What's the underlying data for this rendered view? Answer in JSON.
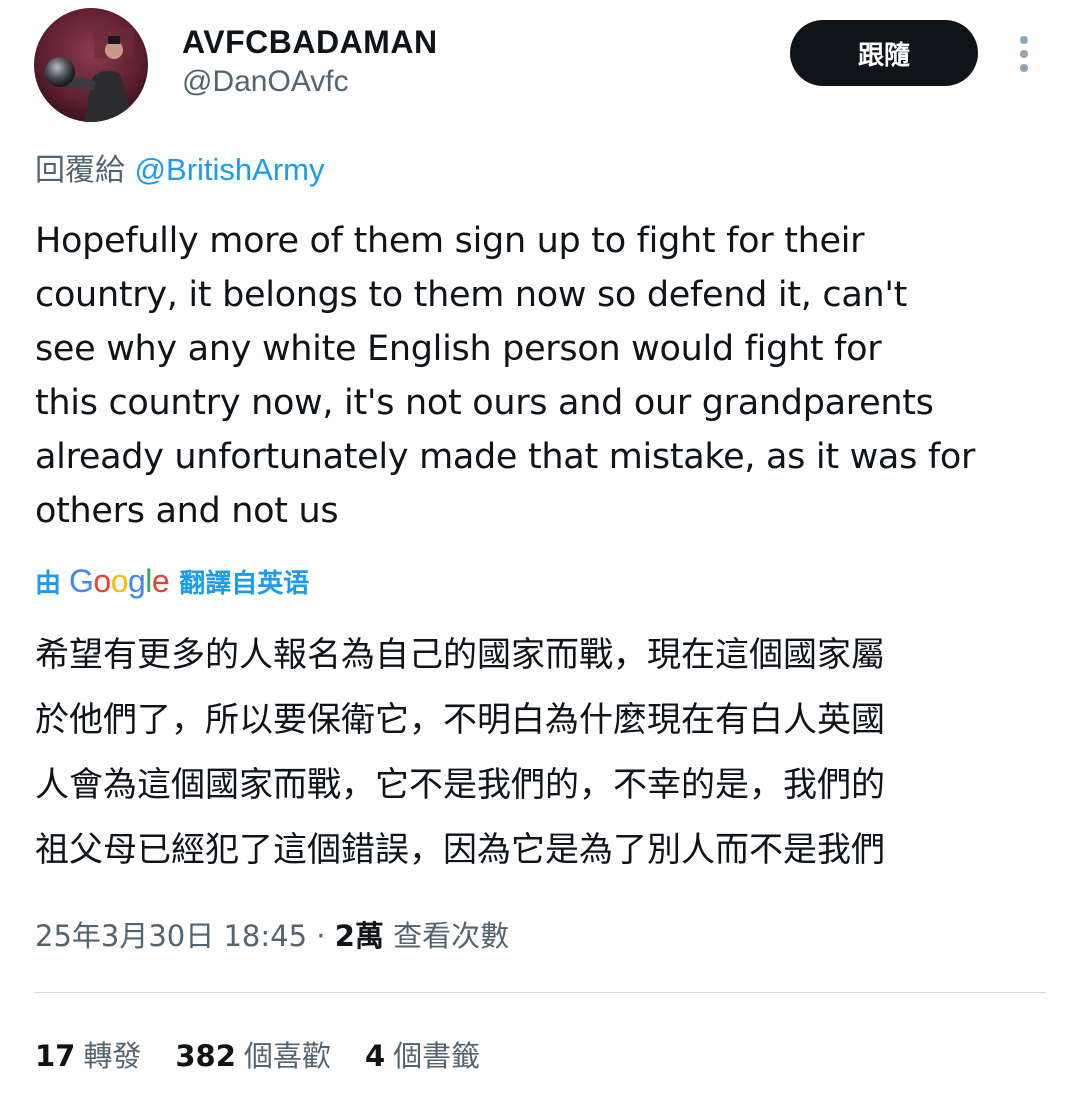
{
  "tweet": {
    "author": {
      "display_name": "AVFCBADAMAN",
      "handle": "@DanOAvfc"
    },
    "follow_label": "跟隨",
    "reply_prefix": "回覆給",
    "reply_to": "@BritishArmy",
    "text": "Hopefully more of them sign up to fight for their\ncountry, it belongs to them now so defend it, can't\nsee why any white English person would fight for\nthis country now, it's not ours and our grandparents\nalready unfortunately made that mistake, as it was for\nothers and not us",
    "translation": {
      "prefix": "由",
      "google_logo": {
        "G": "G",
        "o1": "o",
        "o2": "o",
        "g": "g",
        "l": "l",
        "e": "e"
      },
      "suffix": "翻譯自英语",
      "text": "希望有更多的人報名為自己的國家而戰，現在這個國家屬\n於他們了，所以要保衛它，不明白為什麼現在有白人英國\n人會為這個國家而戰，它不是我們的，不幸的是，我們的\n祖父母已經犯了這個錯誤，因為它是為了別人而不是我們"
    },
    "timestamp": "25年3月30日 18:45",
    "separator": " · ",
    "views_count": "2萬",
    "views_label": "查看次數",
    "stats": {
      "retweets": {
        "count": "17",
        "label": "轉發"
      },
      "likes": {
        "count": "382",
        "label": "個喜歡"
      },
      "bookmarks": {
        "count": "4",
        "label": "個書籤"
      }
    }
  },
  "colors": {
    "text_primary": "#0f1419",
    "text_secondary": "#536471",
    "link_blue": "#1d9bf0",
    "button_bg": "#0f1419",
    "divider": "#cfd9de"
  },
  "icons": {
    "more": "more-vertical-icon",
    "avatar": "user-avatar"
  }
}
